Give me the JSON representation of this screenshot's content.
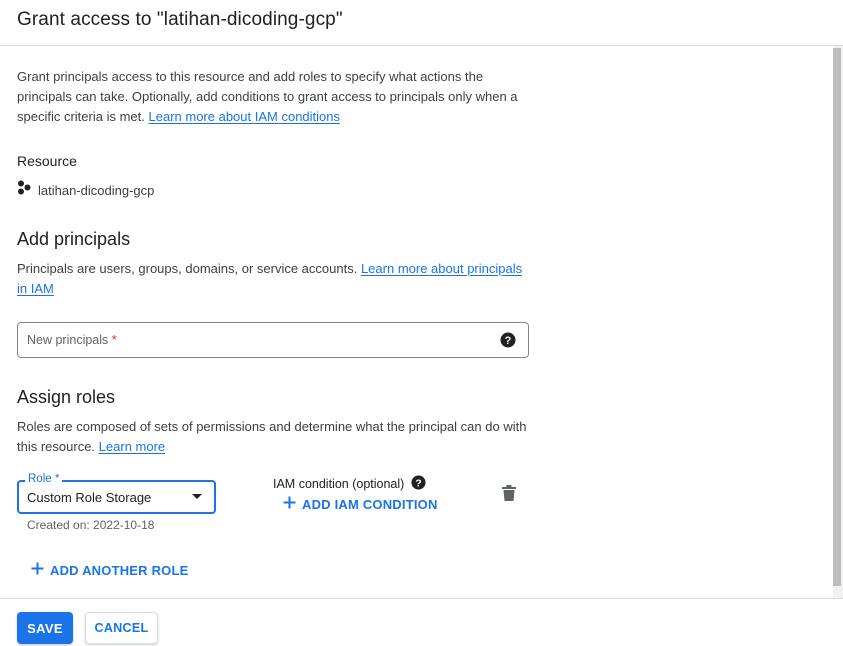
{
  "dialog": {
    "title": "Grant access to \"latihan-dicoding-gcp\""
  },
  "intro": {
    "text": "Grant principals access to this resource and add roles to specify what actions the principals can take. Optionally, add conditions to grant access to principals only when a specific criteria is met.",
    "link": "Learn more about IAM conditions"
  },
  "resource": {
    "heading": "Resource",
    "icon": "project-icon",
    "name": "latihan-dicoding-gcp"
  },
  "add_principals": {
    "heading": "Add principals",
    "description": "Principals are users, groups, domains, or service accounts.",
    "link": "Learn more about principals in IAM",
    "input": {
      "placeholder": "New principals",
      "required_mark": "*",
      "value": ""
    }
  },
  "assign_roles": {
    "heading": "Assign roles",
    "description": "Roles are composed of sets of permissions and determine what the principal can do with this resource.",
    "link": "Learn more",
    "role": {
      "label": "Role *",
      "value": "Custom Role Storage",
      "hint": "Created on: 2022-10-18"
    },
    "iam_condition": {
      "label": "IAM condition (optional)",
      "add_button": "ADD IAM CONDITION"
    },
    "add_another_role": "ADD ANOTHER ROLE"
  },
  "footer": {
    "save": "SAVE",
    "cancel": "CANCEL"
  },
  "colors": {
    "accent": "#1a73e8",
    "required": "#d93025",
    "text": "#202124",
    "secondary_text": "#3c4043",
    "border": "#dadce0"
  }
}
